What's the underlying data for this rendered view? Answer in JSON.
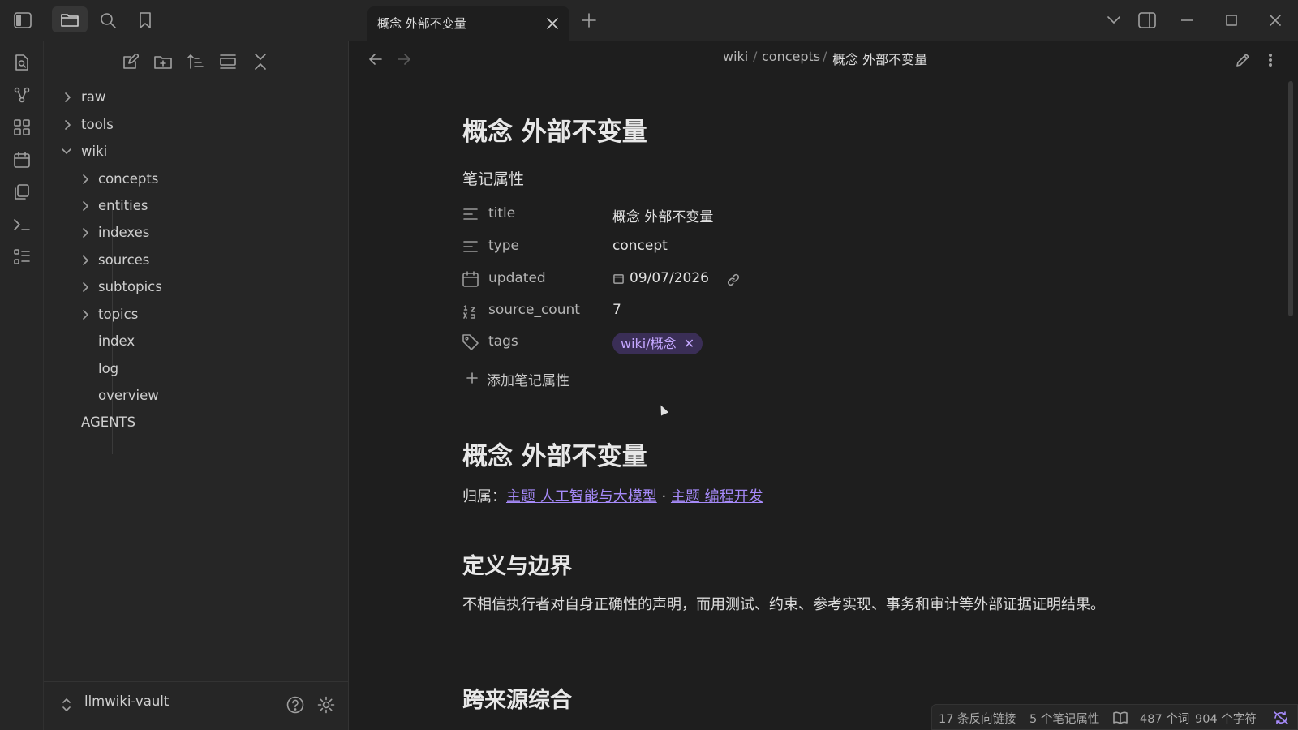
{
  "tab": {
    "title": "概念 外部不变量"
  },
  "breadcrumb": {
    "parts": [
      "wiki",
      "concepts",
      "概念 外部不变量"
    ],
    "sep": "/"
  },
  "sidebar": {
    "tree": [
      {
        "label": "raw",
        "expanded": false
      },
      {
        "label": "tools",
        "expanded": false
      },
      {
        "label": "wiki",
        "expanded": true
      },
      {
        "label": "concepts",
        "expanded": false
      },
      {
        "label": "entities",
        "expanded": false
      },
      {
        "label": "indexes",
        "expanded": false
      },
      {
        "label": "sources",
        "expanded": false
      },
      {
        "label": "subtopics",
        "expanded": false
      },
      {
        "label": "topics",
        "expanded": false
      },
      {
        "label": "index"
      },
      {
        "label": "log"
      },
      {
        "label": "overview"
      },
      {
        "label": "AGENTS"
      }
    ],
    "vault_name": "llmwiki-vault"
  },
  "note": {
    "title": "概念 外部不变量",
    "properties_heading": "笔记属性",
    "properties": [
      {
        "key": "title",
        "value": "概念 外部不变量",
        "icon": "text-lines-icon"
      },
      {
        "key": "type",
        "value": "concept",
        "icon": "text-lines-icon"
      },
      {
        "key": "updated",
        "value": "09/07/2026",
        "icon": "calendar-icon"
      },
      {
        "key": "source_count",
        "value": "7",
        "icon": "number-icon"
      },
      {
        "key": "tags",
        "value": "wiki/概念",
        "icon": "tag-icon"
      }
    ],
    "add_property": "添加笔记属性",
    "h1": "概念 外部不变量",
    "belongs_prefix": "归属：",
    "belongs_links": [
      "主题 人工智能与大模型",
      "主题 编程开发"
    ],
    "belongs_sep": "·",
    "section1": "定义与边界",
    "section1_text": "不相信执行者对自身正确性的声明，而用测试、约束、参考实现、事务和审计等外部证据证明结果。",
    "section2": "跨来源综合"
  },
  "status": {
    "backlinks": "17 条反向链接",
    "props": "5 个笔记属性",
    "words": "487 个词",
    "chars": "904 个字符"
  },
  "colors": {
    "accent": "#a68af9",
    "tag_bg": "#3a2e56",
    "bg": "#1e1e1e",
    "panel": "#262626"
  }
}
